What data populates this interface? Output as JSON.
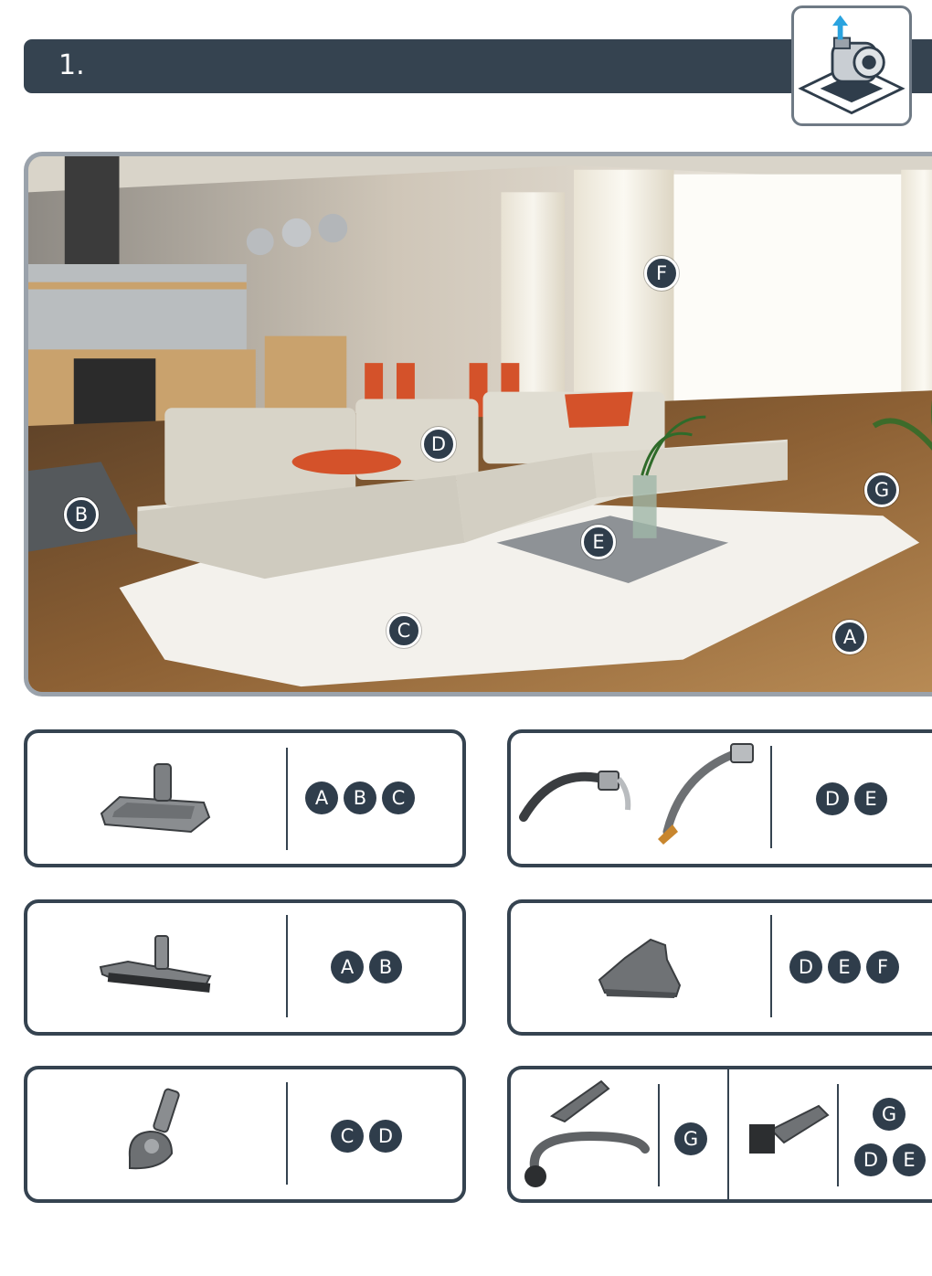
{
  "header": {
    "step_number": "1."
  },
  "room_labels": [
    "A",
    "B",
    "C",
    "D",
    "E",
    "F",
    "G"
  ],
  "accessories": [
    {
      "tool": "floor-nozzle",
      "surfaces": [
        "A",
        "B",
        "C"
      ]
    },
    {
      "tool": "hose-and-wand",
      "surfaces": [
        "D",
        "E"
      ]
    },
    {
      "tool": "parquet-brush",
      "surfaces": [
        "A",
        "B"
      ]
    },
    {
      "tool": "upholstery-nozzle",
      "surfaces": [
        "D",
        "E",
        "F"
      ]
    },
    {
      "tool": "turbo-brush",
      "surfaces": [
        "C",
        "D"
      ]
    },
    {
      "tool": "crevice-tool-flexible",
      "surfaces": [
        "G"
      ]
    },
    {
      "tool": "dusting-brush",
      "surfaces": [
        "G",
        "D",
        "E"
      ]
    }
  ],
  "colors": {
    "dark": "#354350",
    "badge": "#2f3d4b",
    "accent": "#e2572d"
  }
}
